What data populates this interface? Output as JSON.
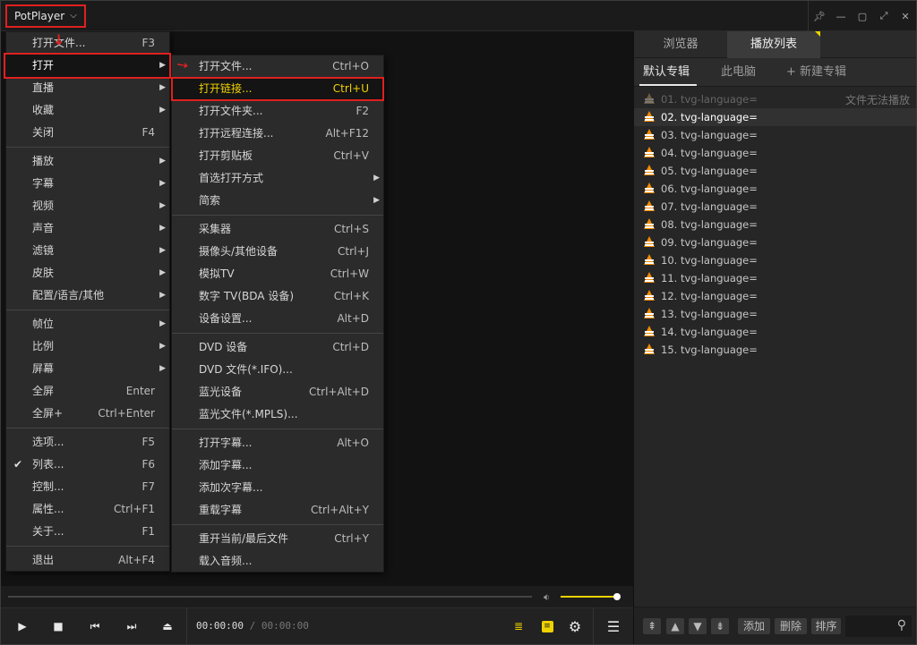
{
  "app": {
    "title": "PotPlayer",
    "watermark": "yer"
  },
  "menu_main": [
    {
      "label": "打开文件...",
      "key": "F3"
    },
    {
      "label": "打开",
      "submenu": true,
      "highlight": true
    },
    {
      "label": "直播",
      "submenu": true
    },
    {
      "label": "收藏",
      "submenu": true
    },
    {
      "label": "关闭",
      "key": "F4"
    },
    {
      "label": "播放",
      "submenu": true
    },
    {
      "label": "字幕",
      "submenu": true
    },
    {
      "label": "视频",
      "submenu": true
    },
    {
      "label": "声音",
      "submenu": true
    },
    {
      "label": "滤镜",
      "submenu": true
    },
    {
      "label": "皮肤",
      "submenu": true
    },
    {
      "label": "配置/语言/其他",
      "submenu": true
    },
    {
      "label": "帧位",
      "submenu": true
    },
    {
      "label": "比例",
      "submenu": true
    },
    {
      "label": "屏幕",
      "submenu": true
    },
    {
      "label": "全屏",
      "key": "Enter"
    },
    {
      "label": "全屏+",
      "key": "Ctrl+Enter"
    },
    {
      "label": "选项...",
      "key": "F5"
    },
    {
      "label": "列表...",
      "key": "F6",
      "checked": true
    },
    {
      "label": "控制...",
      "key": "F7"
    },
    {
      "label": "属性...",
      "key": "Ctrl+F1"
    },
    {
      "label": "关于...",
      "key": "F1"
    },
    {
      "label": "退出",
      "key": "Alt+F4"
    }
  ],
  "menu_open": [
    {
      "label": "打开文件...",
      "key": "Ctrl+O"
    },
    {
      "label": "打开链接...",
      "key": "Ctrl+U",
      "highlight": true
    },
    {
      "label": "打开文件夹...",
      "key": "F2"
    },
    {
      "label": "打开远程连接...",
      "key": "Alt+F12"
    },
    {
      "label": "打开剪贴板",
      "key": "Ctrl+V"
    },
    {
      "label": "首选打开方式",
      "submenu": true
    },
    {
      "label": "简索",
      "submenu": true
    },
    {
      "label": "采集器",
      "key": "Ctrl+S"
    },
    {
      "label": "摄像头/其他设备",
      "key": "Ctrl+J"
    },
    {
      "label": "模拟TV",
      "key": "Ctrl+W"
    },
    {
      "label": "数字 TV(BDA 设备)",
      "key": "Ctrl+K"
    },
    {
      "label": "设备设置...",
      "key": "Alt+D"
    },
    {
      "label": "DVD 设备",
      "key": "Ctrl+D"
    },
    {
      "label": "DVD 文件(*.IFO)..."
    },
    {
      "label": "蓝光设备",
      "key": "Ctrl+Alt+D"
    },
    {
      "label": "蓝光文件(*.MPLS)..."
    },
    {
      "label": "打开字幕...",
      "key": "Alt+O"
    },
    {
      "label": "添加字幕..."
    },
    {
      "label": "添加次字幕..."
    },
    {
      "label": "重载字幕",
      "key": "Ctrl+Alt+Y"
    },
    {
      "label": "重开当前/最后文件",
      "key": "Ctrl+Y"
    },
    {
      "label": "载入音频..."
    }
  ],
  "panel": {
    "tabs": [
      "浏览器",
      "播放列表"
    ],
    "active_tab": 1,
    "subtabs": [
      "默认专辑",
      "此电脑",
      "+ 新建专辑"
    ],
    "items": [
      {
        "label": "01. tvg-language=",
        "status": "文件无法播放",
        "disabled": true
      },
      {
        "label": "02. tvg-language=",
        "current": true
      },
      {
        "label": "03. tvg-language="
      },
      {
        "label": "04. tvg-language="
      },
      {
        "label": "05. tvg-language="
      },
      {
        "label": "06. tvg-language="
      },
      {
        "label": "07. tvg-language="
      },
      {
        "label": "08. tvg-language="
      },
      {
        "label": "09. tvg-language="
      },
      {
        "label": "10. tvg-language="
      },
      {
        "label": "11. tvg-language="
      },
      {
        "label": "12. tvg-language="
      },
      {
        "label": "13. tvg-language="
      },
      {
        "label": "14. tvg-language="
      },
      {
        "label": "15. tvg-language="
      }
    ],
    "footer": {
      "add": "添加",
      "delete": "删除",
      "sort": "排序"
    }
  },
  "player": {
    "time_current": "00:00:00",
    "time_sep": "/",
    "time_total": "00:00:00",
    "volume_fraction": 0.95
  },
  "colors": {
    "accent": "#f0d200",
    "annotation": "#e02020",
    "cone": "#f08a00"
  }
}
